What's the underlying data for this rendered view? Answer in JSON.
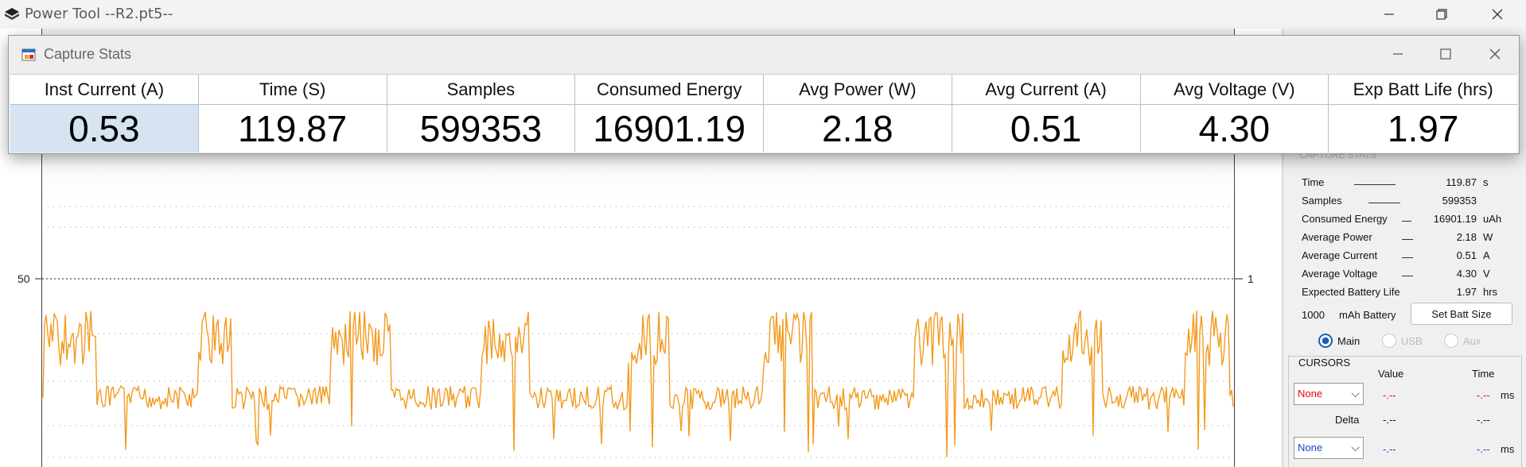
{
  "main_window": {
    "title": "Power Tool --R2.pt5--"
  },
  "capture_window": {
    "title": "Capture Stats",
    "columns": [
      {
        "header": "Inst Current (A)",
        "value": "0.53"
      },
      {
        "header": "Time (S)",
        "value": "119.87"
      },
      {
        "header": "Samples",
        "value": "599353"
      },
      {
        "header": "Consumed Energy",
        "value": "16901.19"
      },
      {
        "header": "Avg Power (W)",
        "value": "2.18"
      },
      {
        "header": "Avg Current (A)",
        "value": "0.51"
      },
      {
        "header": "Avg Voltage (V)",
        "value": "4.30"
      },
      {
        "header": "Exp Batt Life (hrs)",
        "value": "1.97"
      }
    ]
  },
  "plot": {
    "left_axis_label": "50",
    "right_axis_label": "1",
    "trace_color": "#f39a1e"
  },
  "right_panel": {
    "section_title": "CAPTURE STATS",
    "stats": [
      {
        "label": "Time",
        "value": "119.87",
        "unit": "s"
      },
      {
        "label": "Samples",
        "value": "599353",
        "unit": ""
      },
      {
        "label": "Consumed Energy",
        "value": "16901.19",
        "unit": "uAh"
      },
      {
        "label": "Average Power",
        "value": "2.18",
        "unit": "W"
      },
      {
        "label": "Average Current",
        "value": "0.51",
        "unit": "A"
      },
      {
        "label": "Average Voltage",
        "value": "4.30",
        "unit": "V"
      },
      {
        "label": "Expected Battery Life",
        "value": "1.97",
        "unit": "hrs"
      }
    ],
    "battery_size": "1000",
    "battery_label": "mAh Battery",
    "set_batt_button": "Set Batt Size",
    "radios": [
      "Main",
      "USB",
      "Aux"
    ],
    "cursors": {
      "title": "CURSORS",
      "value_header": "Value",
      "time_header": "Time",
      "delta_label": "Delta",
      "cursor1_select": "None",
      "cursor2_select": "None",
      "placeholder": "-.--",
      "unit": "ms"
    }
  }
}
